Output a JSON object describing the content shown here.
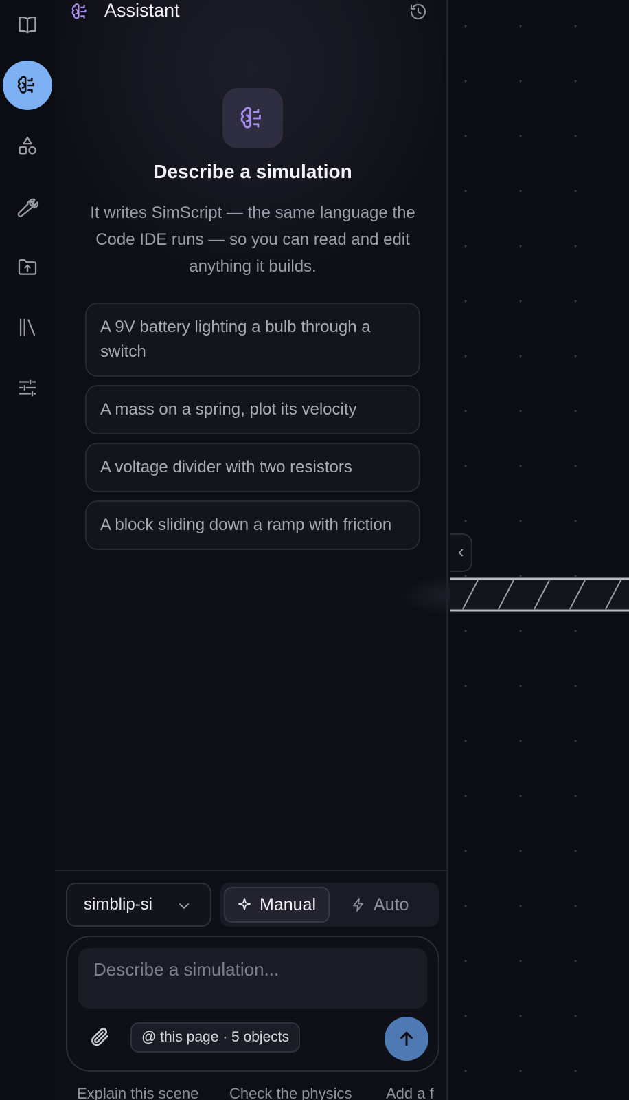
{
  "header": {
    "title": "Assistant"
  },
  "rail": {
    "items": [
      {
        "icon": "book-icon"
      },
      {
        "icon": "brain-icon",
        "active": true
      },
      {
        "icon": "shapes-icon"
      },
      {
        "icon": "wrench-icon"
      },
      {
        "icon": "folder-upload-icon"
      },
      {
        "icon": "library-icon"
      },
      {
        "icon": "sliders-icon"
      }
    ]
  },
  "hero": {
    "title": "Describe a simulation",
    "description": "It writes SimScript — the same language the Code IDE runs — so you can read and edit anything it builds."
  },
  "suggestions": [
    "A 9V battery lighting a bulb through a switch",
    "A mass on a spring, plot its velocity",
    "A voltage divider with two resistors",
    "A block sliding down a ramp with friction"
  ],
  "model": {
    "selected": "simblip-si"
  },
  "mode": {
    "manual_label": "Manual",
    "auto_label": "Auto",
    "selected": "Manual"
  },
  "composer": {
    "placeholder": "Describe a simulation...",
    "context_chip": "@ this page · 5 objects"
  },
  "quick_actions": [
    "Explain this scene",
    "Check the physics",
    "Add a f"
  ],
  "colors": {
    "accent": "#7eb1f4",
    "brain_purple": "#a98ef0",
    "send": "#4e79b3",
    "background": "#0d0e14"
  }
}
